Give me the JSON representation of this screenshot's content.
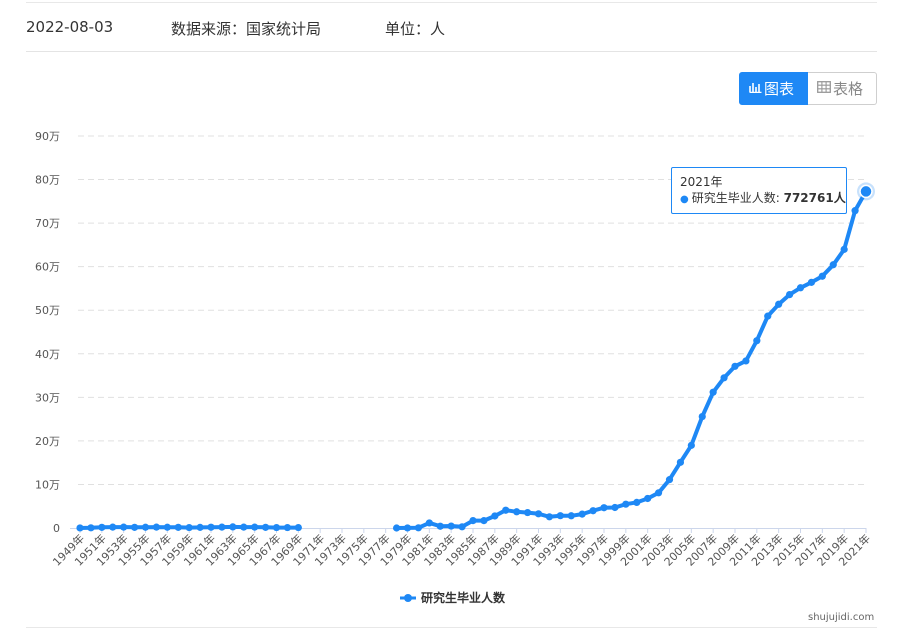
{
  "header": {
    "date": "2022-08-03",
    "source": "数据来源：国家统计局",
    "unit": "单位：人"
  },
  "toggle": {
    "chart_label": "图表",
    "table_label": "表格",
    "chart_icon": "chart-icon",
    "table_icon": "table-icon"
  },
  "tooltip": {
    "year": "2021年",
    "series": "研究生毕业人数: ",
    "value": "772761人"
  },
  "watermark": "shujujidi.com",
  "colors": {
    "series": "#1e88f5",
    "grid": "#e0e0e0",
    "axis": "#ccd6eb"
  },
  "chart_data": {
    "type": "line",
    "y_tick_labels": [
      "0",
      "10万",
      "20万",
      "30万",
      "40万",
      "50万",
      "60万",
      "70万",
      "80万",
      "90万"
    ],
    "ylim": [
      0,
      900000
    ],
    "grid": true,
    "legend_position": "bottom-center",
    "x": [
      1949,
      1950,
      1951,
      1952,
      1953,
      1954,
      1955,
      1956,
      1957,
      1958,
      1959,
      1960,
      1961,
      1962,
      1963,
      1964,
      1965,
      1966,
      1967,
      1968,
      1969,
      1970,
      1971,
      1972,
      1973,
      1974,
      1975,
      1976,
      1977,
      1978,
      1979,
      1980,
      1981,
      1982,
      1983,
      1984,
      1985,
      1986,
      1987,
      1988,
      1989,
      1990,
      1991,
      1992,
      1993,
      1994,
      1995,
      1996,
      1997,
      1998,
      1999,
      2000,
      2001,
      2002,
      2003,
      2004,
      2005,
      2006,
      2007,
      2008,
      2009,
      2010,
      2011,
      2012,
      2013,
      2014,
      2015,
      2016,
      2017,
      2018,
      2019,
      2020,
      2021
    ],
    "x_tick_labels": [
      "1949年",
      "1951年",
      "1953年",
      "1955年",
      "1957年",
      "1959年",
      "1961年",
      "1963年",
      "1965年",
      "1967年",
      "1969年",
      "1971年",
      "1973年",
      "1975年",
      "1977年",
      "1979年",
      "1981年",
      "1983年",
      "1985年",
      "1987年",
      "1989年",
      "1991年",
      "1993年",
      "1995年",
      "1997年",
      "1999年",
      "2001年",
      "2003年",
      "2005年",
      "2007年",
      "2009年",
      "2011年",
      "2013年",
      "2015年",
      "2017年",
      "2019年",
      "2021年"
    ],
    "series": [
      {
        "name": "研究生毕业人数",
        "values": [
          107,
          400,
          1500,
          2000,
          2000,
          1500,
          1700,
          2000,
          1700,
          1500,
          1000,
          1400,
          1800,
          2000,
          2500,
          2000,
          2000,
          1500,
          1000,
          1000,
          1000,
          null,
          null,
          null,
          null,
          null,
          null,
          null,
          null,
          9,
          140,
          476,
          11669,
          4058,
          4497,
          2756,
          17004,
          16950,
          27603,
          40838,
          37232,
          35440,
          32537,
          25692,
          28214,
          28047,
          31877,
          39652,
          46539,
          47077,
          54670,
          58767,
          67809,
          80841,
          111091,
          150777,
          189728,
          255902,
          311839,
          344825,
          371273,
          383600,
          429994,
          486455,
          513626,
          535863,
          551522,
          563938,
          578045,
          604368,
          639666,
          728627,
          772761
        ]
      }
    ]
  }
}
